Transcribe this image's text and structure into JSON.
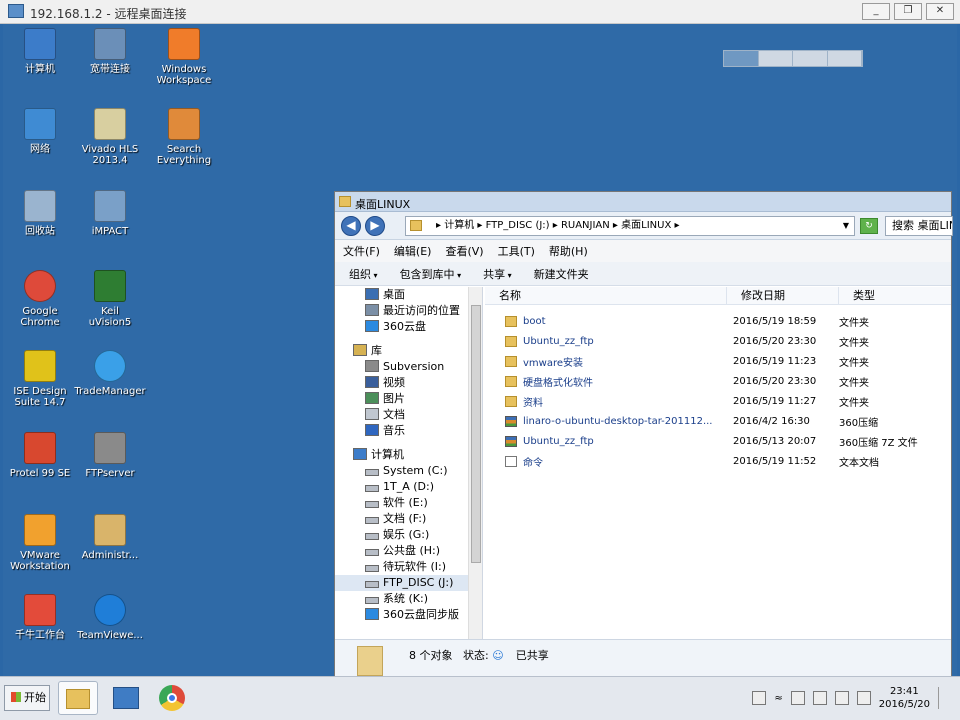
{
  "rdp": {
    "title": "192.168.1.2 - 远程桌面连接"
  },
  "desktop_icons": [
    {
      "label": "计算机",
      "icon": "computer-icon",
      "color": "#3c7cc9"
    },
    {
      "label": "宽带连接",
      "icon": "network-connection-icon",
      "color": "#6b8fb8"
    },
    {
      "label": "Windows\nWorkspace",
      "icon": "windows-workspace-icon",
      "color": "#f07c2a"
    },
    {
      "label": "网络",
      "icon": "network-icon",
      "color": "#3f8bd3"
    },
    {
      "label": "Vivado HLS\n2013.4",
      "icon": "vivado-hls-icon",
      "color": "#d8cfa0"
    },
    {
      "label": "Search\nEverything",
      "icon": "search-everything-icon",
      "color": "#e08a3a"
    },
    {
      "label": "回收站",
      "icon": "recycle-bin-icon",
      "color": "#9ab4cf"
    },
    {
      "label": "iMPACT",
      "icon": "impact-icon",
      "color": "#7aa0c8"
    },
    {
      "label": "Google\nChrome",
      "icon": "chrome-icon",
      "color": "#de4a3a"
    },
    {
      "label": "Keil\nuVision5",
      "icon": "keil-icon",
      "color": "#2e7d32"
    },
    {
      "label": "ISE Design\nSuite 14.7",
      "icon": "ise-design-icon",
      "color": "#e0c21a"
    },
    {
      "label": "TradeManager",
      "icon": "trademanager-icon",
      "color": "#3aa0e8"
    },
    {
      "label": "Protel 99 SE",
      "icon": "protel-icon",
      "color": "#d8482f"
    },
    {
      "label": "FTPserver",
      "icon": "ftpserver-icon",
      "color": "#8a8a8a"
    },
    {
      "label": "VMware\nWorkstation",
      "icon": "vmware-icon",
      "color": "#f1a12e"
    },
    {
      "label": "Administr...",
      "icon": "user-folder-icon",
      "color": "#d9b46a"
    },
    {
      "label": "千牛工作台",
      "icon": "qianniu-icon",
      "color": "#e34b3a"
    },
    {
      "label": "TeamViewe...",
      "icon": "teamviewer-icon",
      "color": "#1f7ed8"
    }
  ],
  "explorer": {
    "title": "桌面LINUX",
    "breadcrumb": "▸ 计算机 ▸ FTP_DISC (J:) ▸ RUANJIAN ▸ 桌面LINUX ▸",
    "search_placeholder": "搜索 桌面LINUX",
    "menu": [
      "文件(F)",
      "编辑(E)",
      "查看(V)",
      "工具(T)",
      "帮助(H)"
    ],
    "toolbar": [
      "组织",
      "包含到库中",
      "共享",
      "新建文件夹"
    ],
    "nav": [
      {
        "label": "桌面",
        "icon": "desktop-icon",
        "indent": 1
      },
      {
        "label": "最近访问的位置",
        "icon": "recent-places-icon",
        "indent": 1
      },
      {
        "label": "360云盘",
        "icon": "cloud-icon",
        "indent": 1
      },
      {
        "label": "",
        "icon": "",
        "indent": 0
      },
      {
        "label": "库",
        "icon": "library-icon",
        "indent": 0
      },
      {
        "label": "Subversion",
        "icon": "subversion-icon",
        "indent": 1
      },
      {
        "label": "视频",
        "icon": "video-icon",
        "indent": 1
      },
      {
        "label": "图片",
        "icon": "pictures-icon",
        "indent": 1
      },
      {
        "label": "文档",
        "icon": "documents-icon",
        "indent": 1
      },
      {
        "label": "音乐",
        "icon": "music-icon",
        "indent": 1
      },
      {
        "label": "",
        "icon": "",
        "indent": 0
      },
      {
        "label": "计算机",
        "icon": "computer-icon",
        "indent": 0
      },
      {
        "label": "System (C:)",
        "icon": "drive-icon",
        "indent": 1
      },
      {
        "label": "1T_A (D:)",
        "icon": "drive-icon",
        "indent": 1
      },
      {
        "label": "软件 (E:)",
        "icon": "drive-icon",
        "indent": 1
      },
      {
        "label": "文档 (F:)",
        "icon": "drive-icon",
        "indent": 1
      },
      {
        "label": "娱乐 (G:)",
        "icon": "drive-icon",
        "indent": 1
      },
      {
        "label": "公共盘 (H:)",
        "icon": "drive-icon",
        "indent": 1
      },
      {
        "label": "待玩软件 (I:)",
        "icon": "drive-icon",
        "indent": 1
      },
      {
        "label": "FTP_DISC (J:)",
        "icon": "drive-icon",
        "indent": 1,
        "selected": true
      },
      {
        "label": "系统 (K:)",
        "icon": "drive-icon",
        "indent": 1
      },
      {
        "label": "360云盘同步版",
        "icon": "cloud-icon",
        "indent": 1
      }
    ],
    "columns": {
      "name": "名称",
      "date": "修改日期",
      "type": "类型"
    },
    "files": [
      {
        "name": "boot",
        "date": "2016/5/19 18:59",
        "type": "文件夹",
        "kind": "folder"
      },
      {
        "name": "Ubuntu_zz_ftp",
        "date": "2016/5/20 23:30",
        "type": "文件夹",
        "kind": "folder"
      },
      {
        "name": "vmware安装",
        "date": "2016/5/19 11:23",
        "type": "文件夹",
        "kind": "folder"
      },
      {
        "name": "硬盘格式化软件",
        "date": "2016/5/20 23:30",
        "type": "文件夹",
        "kind": "folder"
      },
      {
        "name": "资料",
        "date": "2016/5/19 11:27",
        "type": "文件夹",
        "kind": "folder"
      },
      {
        "name": "linaro-o-ubuntu-desktop-tar-201112...",
        "date": "2016/4/2 16:30",
        "type": "360压缩",
        "kind": "zip"
      },
      {
        "name": "Ubuntu_zz_ftp",
        "date": "2016/5/13 20:07",
        "type": "360压缩 7Z 文件",
        "kind": "zip"
      },
      {
        "name": "命令",
        "date": "2016/5/19 11:52",
        "type": "文本文档",
        "kind": "txt"
      }
    ],
    "status": {
      "count": "8 个对象",
      "state_label": "状态:",
      "state_value": "已共享"
    }
  },
  "taskbar": {
    "start": "开始",
    "apps": [
      "explorer-icon",
      "network-manager-icon",
      "chrome-icon"
    ],
    "clock_time": "23:41",
    "clock_date": "2016/5/20"
  }
}
